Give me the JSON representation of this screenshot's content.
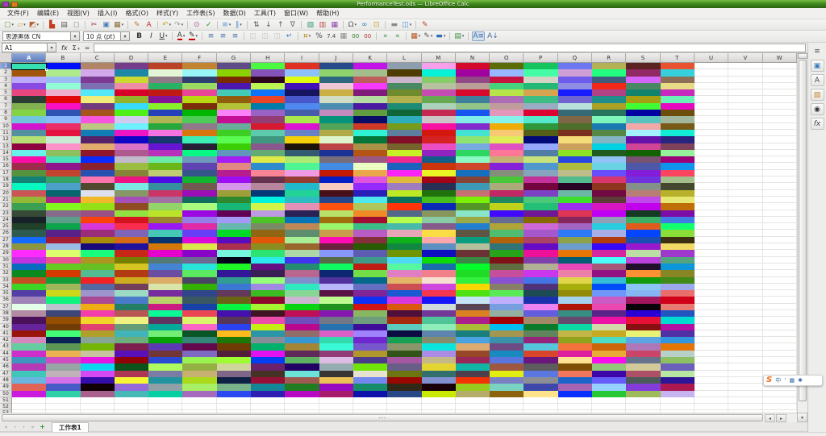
{
  "window": {
    "title": "PerformanceTest.ods — LibreOffice Calc",
    "left_icons": [
      {
        "name": "window-badge-1",
        "color": "#a43bbf"
      },
      {
        "name": "window-badge-2",
        "color": "#e07a1f"
      }
    ]
  },
  "menu": {
    "items": [
      "文件(F)",
      "编辑(E)",
      "视图(V)",
      "插入(I)",
      "格式(O)",
      "样式(Y)",
      "工作表(S)",
      "数据(D)",
      "工具(T)",
      "窗口(W)",
      "帮助(H)"
    ]
  },
  "standard_toolbar": {
    "icons": [
      {
        "n": "new-document",
        "g": "▢",
        "c": "#6a994a",
        "d": 1
      },
      {
        "n": "open-file",
        "g": "▱",
        "c": "#d8a44c",
        "d": 1
      },
      {
        "n": "save",
        "g": "◩",
        "c": "#b06030",
        "d": 1
      },
      {
        "sep": true
      },
      {
        "n": "export-as-pdf",
        "g": "▙",
        "c": "#c23b22"
      },
      {
        "n": "print",
        "g": "▤",
        "c": "#5a5a5a"
      },
      {
        "n": "print-preview",
        "g": "◻",
        "c": "#8a8a8a"
      },
      {
        "sep": true
      },
      {
        "n": "cut",
        "g": "✂",
        "c": "#a23333"
      },
      {
        "n": "copy",
        "g": "▣",
        "c": "#4a7ebb"
      },
      {
        "n": "paste",
        "g": "▦",
        "c": "#8a6d3b",
        "d": 1
      },
      {
        "sep": true
      },
      {
        "n": "clone-formatting",
        "g": "✎",
        "c": "#c07830"
      },
      {
        "n": "clear-formatting",
        "g": "A",
        "c": "#c03030"
      },
      {
        "sep": true
      },
      {
        "n": "undo",
        "g": "↶",
        "c": "#c9a227",
        "d": 1
      },
      {
        "n": "redo",
        "g": "↷",
        "c": "#999999",
        "d": 1
      },
      {
        "sep": true
      },
      {
        "n": "find-and-replace",
        "g": "⊙",
        "c": "#a4589a"
      },
      {
        "n": "spelling",
        "g": "✓",
        "c": "#3a8f3a"
      },
      {
        "sep": true
      },
      {
        "n": "insert-row",
        "g": "≡",
        "c": "#4a90d9",
        "d": 1
      },
      {
        "n": "insert-column",
        "g": "∥",
        "c": "#4a90d9",
        "d": 1
      },
      {
        "sep": true
      },
      {
        "n": "sort",
        "g": "⇅",
        "c": "#555555"
      },
      {
        "n": "sort-ascending",
        "g": "↓",
        "c": "#555555"
      },
      {
        "n": "sort-descending",
        "g": "↑",
        "c": "#555555"
      },
      {
        "n": "autofilter",
        "g": "∇",
        "c": "#666666"
      },
      {
        "sep": true
      },
      {
        "n": "insert-image",
        "g": "▧",
        "c": "#3a9b7a"
      },
      {
        "n": "insert-chart",
        "g": "▥",
        "c": "#c0504d"
      },
      {
        "n": "insert-pivot-table",
        "g": "▦",
        "c": "#8e44ad"
      },
      {
        "sep": true
      },
      {
        "n": "insert-special-character",
        "g": "Ω",
        "c": "#555555",
        "d": 1
      },
      {
        "n": "insert-hyperlink",
        "g": "∞",
        "c": "#2980b9"
      },
      {
        "n": "insert-comment",
        "g": "⊡",
        "c": "#c9a227"
      },
      {
        "sep": true
      },
      {
        "n": "headers-and-footers",
        "g": "▬",
        "c": "#888888"
      },
      {
        "n": "freeze-rows-and-columns",
        "g": "◫",
        "c": "#4a90d9",
        "d": 1
      },
      {
        "sep": true
      },
      {
        "n": "show-draw-functions",
        "g": "✎",
        "c": "#c23b22"
      }
    ]
  },
  "formatting_toolbar": {
    "font_name": "思源黑体 CN",
    "font_size": "10 点 (pt)",
    "icons": [
      {
        "n": "bold",
        "g": "B",
        "c": "#333333",
        "b": 1
      },
      {
        "n": "italic",
        "g": "I",
        "c": "#333333",
        "i": 1
      },
      {
        "n": "underline",
        "g": "U",
        "c": "#333333",
        "u": 1,
        "d": 1
      },
      {
        "sep": true
      },
      {
        "n": "font-color",
        "g": "A",
        "c": "#333333",
        "bar": "#cc0000",
        "d": 1
      },
      {
        "n": "highlighting-color",
        "g": "✎",
        "c": "#333333",
        "bar": "#cc0000",
        "d": 1
      },
      {
        "sep": true
      },
      {
        "n": "align-left",
        "g": "≡",
        "c": "#456ca8"
      },
      {
        "n": "align-center",
        "g": "≡",
        "c": "#456ca8"
      },
      {
        "n": "align-right",
        "g": "≡",
        "c": "#456ca8"
      },
      {
        "sep": true
      },
      {
        "n": "merge-and-center-cells",
        "g": "◫",
        "c": "#777777",
        "dim": 1
      },
      {
        "n": "merge-cells",
        "g": "◫",
        "c": "#777777",
        "dim": 1
      },
      {
        "n": "unmerge-cells",
        "g": "◫",
        "c": "#777777",
        "dim": 1
      },
      {
        "n": "wrap-text",
        "g": "↵",
        "c": "#3a7ebf"
      },
      {
        "sep": true
      },
      {
        "n": "format-as-currency",
        "g": "¤",
        "c": "#b8860b",
        "d": 1
      },
      {
        "n": "format-as-percent",
        "g": "%",
        "c": "#444444"
      },
      {
        "n": "format-as-number",
        "g": "7.4",
        "c": "#444444",
        "fs": 7
      },
      {
        "n": "format-as-date",
        "g": "▦",
        "c": "#888888"
      },
      {
        "n": "add-decimal-place",
        "g": "00",
        "c": "#2a7a2a",
        "fs": 7
      },
      {
        "n": "delete-decimal-place",
        "g": "00",
        "c": "#b23030",
        "fs": 7
      },
      {
        "sep": true
      },
      {
        "n": "increase-indent",
        "g": "»",
        "c": "#3a8f3a"
      },
      {
        "n": "decrease-indent",
        "g": "«",
        "c": "#3a8f3a"
      },
      {
        "sep": true
      },
      {
        "n": "borders",
        "g": "▦",
        "c": "#b5541c",
        "d": 1
      },
      {
        "n": "border-style",
        "g": "✎",
        "c": "#555555",
        "d": 1
      },
      {
        "n": "border-color",
        "g": "▬",
        "c": "#2e6fbd",
        "d": 1
      },
      {
        "sep": true
      },
      {
        "n": "conditional-formatting",
        "g": "▤",
        "c": "#3a8f3a",
        "d": 1
      },
      {
        "sep": true
      },
      {
        "n": "text-direction-left-to-right",
        "g": "A≡",
        "c": "#456ca8",
        "pressed": 1
      },
      {
        "n": "text-direction-top-to-bottom",
        "g": "A↓",
        "c": "#456ca8"
      }
    ]
  },
  "formula_bar": {
    "cell_reference": "A1",
    "function_wizard_label": "fx",
    "sum_label": "Σ",
    "formula_label": "=",
    "input_value": ""
  },
  "grid": {
    "columns": [
      "A",
      "B",
      "C",
      "D",
      "E",
      "F",
      "G",
      "H",
      "I",
      "J",
      "K",
      "L",
      "M",
      "N",
      "O",
      "P",
      "Q",
      "R",
      "S",
      "T",
      "U",
      "V",
      "W"
    ],
    "selected_column": "A",
    "selected_row": 1,
    "selected_cell": "A1",
    "selected_cell_color": "#38dfb2",
    "visible_rows": 53,
    "data_rows": 50,
    "data_cols": 20,
    "fill": "random-colors",
    "color_seed": 7
  },
  "scrollbars": {
    "h_left_arrow": "◂",
    "h_right_arrow": "▸",
    "v_down_arrow": "▾",
    "grip": "∙∙∙"
  },
  "sheet_bar": {
    "nav": [
      {
        "name": "first-sheet",
        "glyph": "«"
      },
      {
        "name": "previous-sheet",
        "glyph": "‹"
      },
      {
        "name": "next-sheet",
        "glyph": "›"
      },
      {
        "name": "last-sheet",
        "glyph": "»"
      }
    ],
    "add_sheet_label": "+",
    "tabs": [
      {
        "label": "工作表1",
        "active": true
      }
    ]
  },
  "sidebar": {
    "icons": [
      {
        "name": "sidebar-settings",
        "glyph": "≡",
        "color": "#555555",
        "flat": 1
      },
      {
        "name": "properties",
        "glyph": "▣",
        "color": "#3a7ebf"
      },
      {
        "name": "styles",
        "glyph": "A",
        "color": "#444444"
      },
      {
        "name": "gallery",
        "glyph": "▨",
        "color": "#c8872c"
      },
      {
        "name": "navigator",
        "glyph": "◉",
        "color": "#333333"
      },
      {
        "name": "functions",
        "glyph": "fx",
        "color": "#444444",
        "italic": 1
      }
    ]
  },
  "ime": {
    "logo": "S",
    "logo_color": "#f06a1d",
    "items": [
      {
        "name": "chinese-mode",
        "glyph": "中"
      },
      {
        "name": "punctuation-mode",
        "glyph": "’"
      },
      {
        "name": "soft-keyboard",
        "glyph": "▦"
      },
      {
        "name": "ime-settings",
        "glyph": "✱"
      }
    ]
  },
  "colors": {
    "titlebar_green": "#3f8c1d",
    "selected_header_blue": "#5d7cbe"
  }
}
